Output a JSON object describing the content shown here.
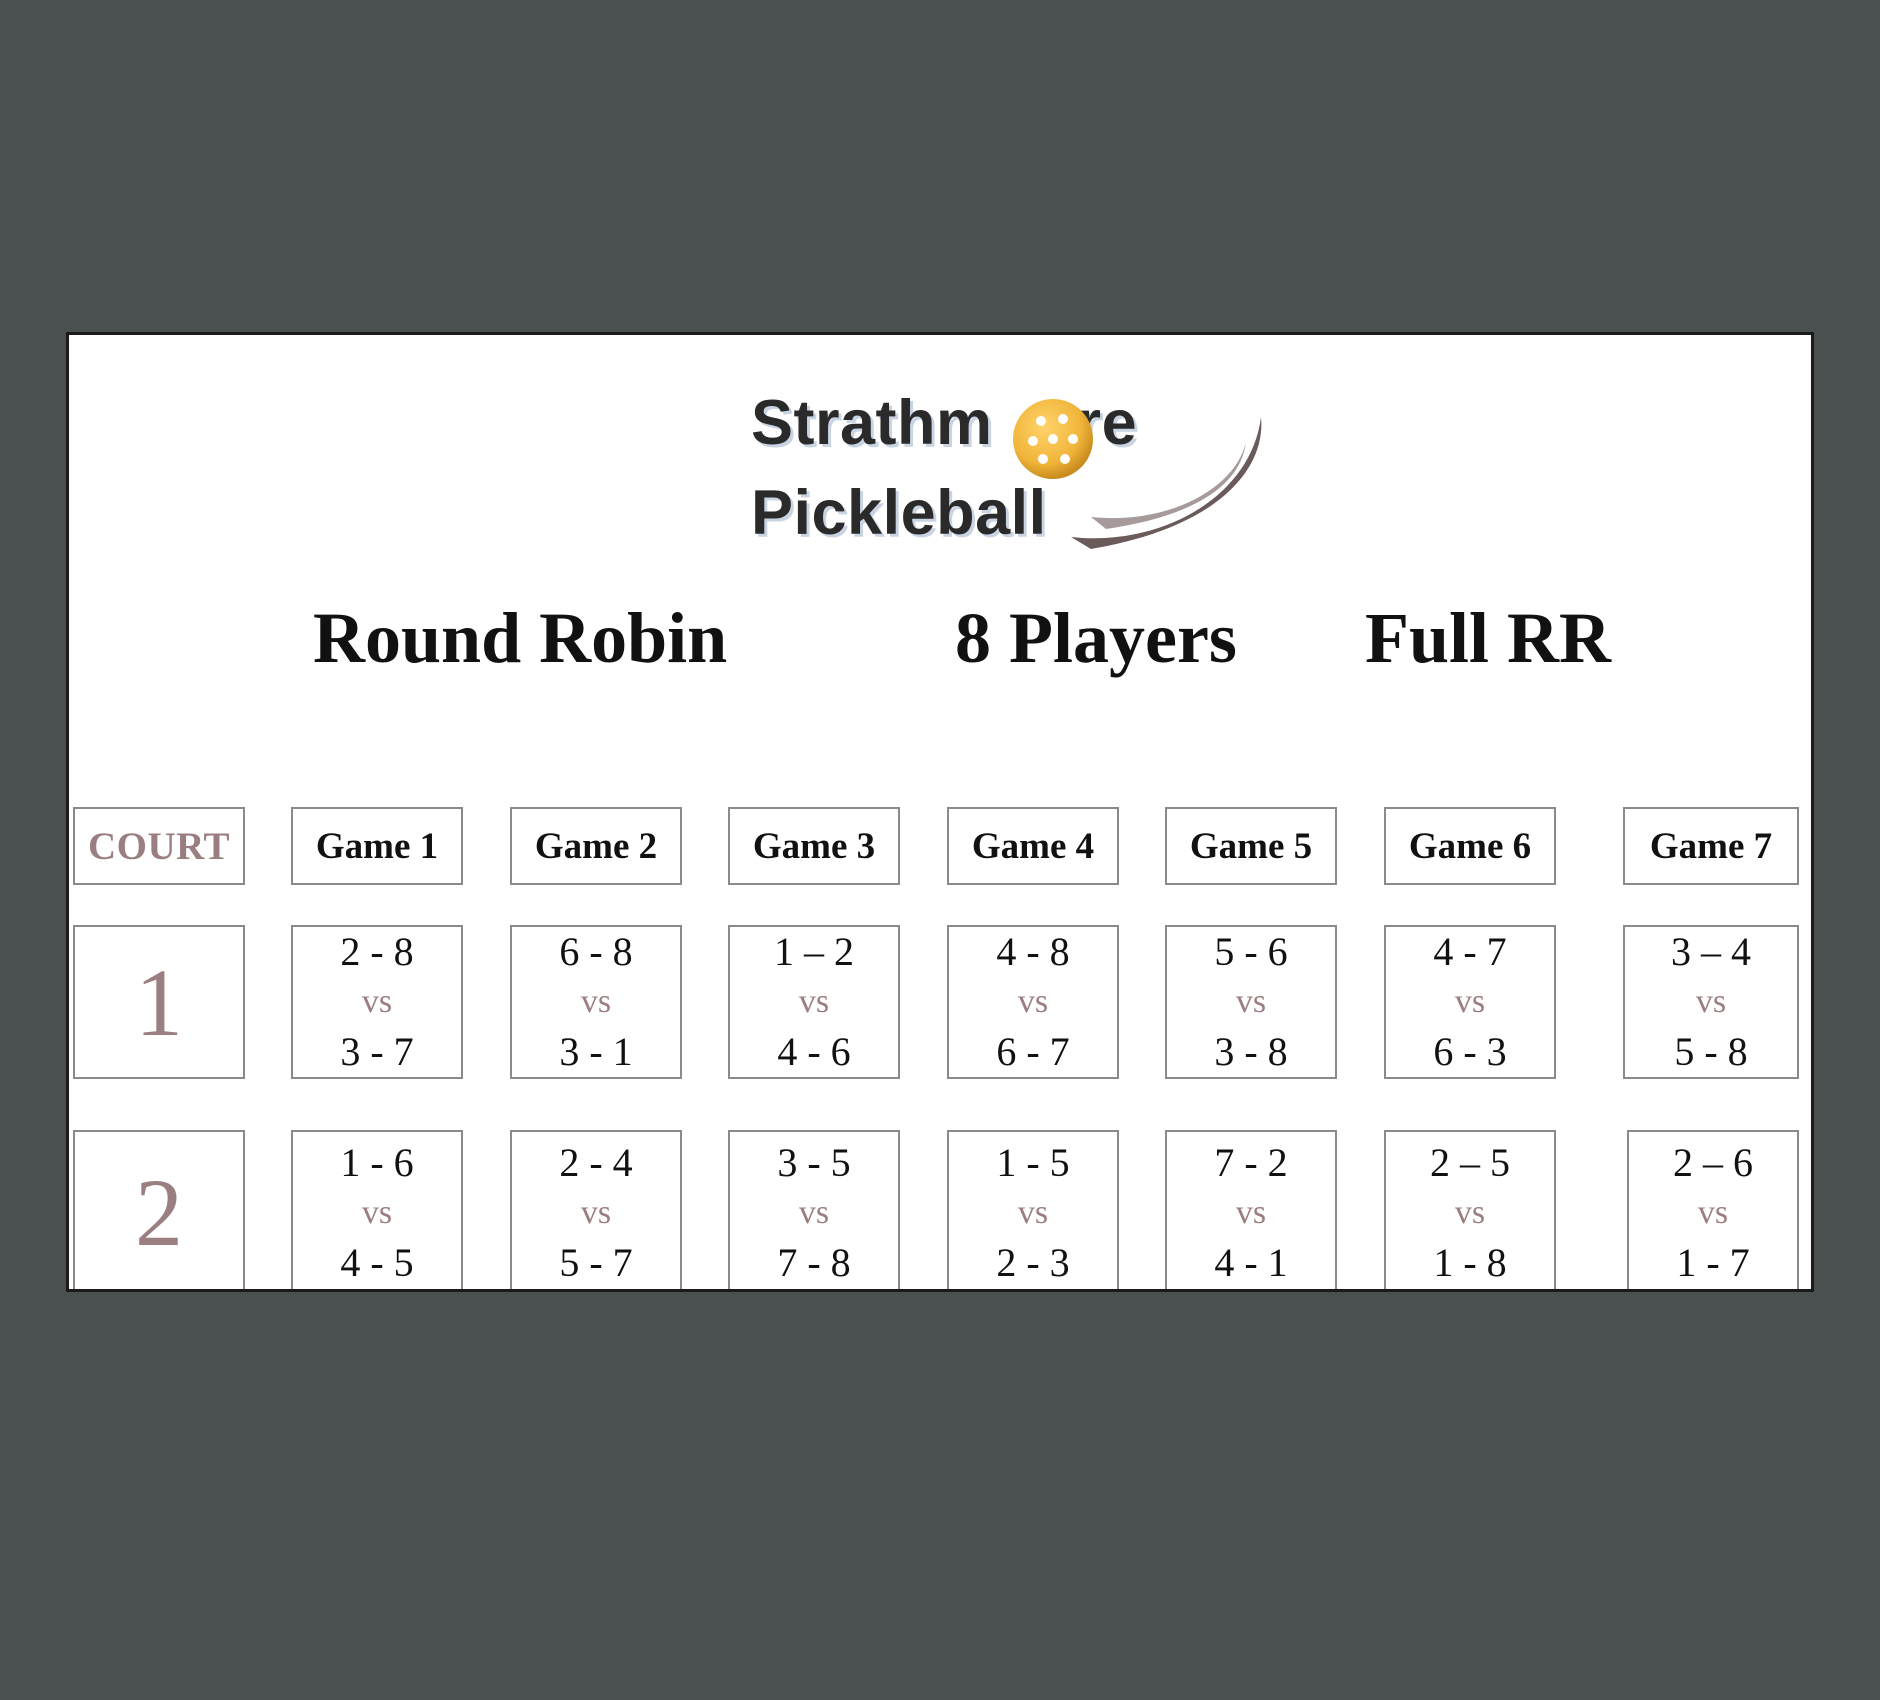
{
  "logo": {
    "line1_a": "Strathm",
    "line1_b": "re",
    "line2": "Pickleball",
    "ball_color": "#f0b53a",
    "swoosh_color": "#6a5a5a"
  },
  "heading": {
    "title": "Round Robin",
    "players": "8 Players",
    "format": "Full RR"
  },
  "colors": {
    "accent": "#9b7f80",
    "border": "#8a8a8a",
    "background": "#4a5050"
  },
  "table": {
    "court_header": "COURT",
    "vs_label": "vs",
    "games": [
      "Game 1",
      "Game 2",
      "Game 3",
      "Game 4",
      "Game 5",
      "Game 6",
      "Game 7"
    ],
    "courts": [
      {
        "number": "1",
        "matches": [
          {
            "team1": "2 - 8",
            "team2": "3 - 7"
          },
          {
            "team1": "6 - 8",
            "team2": "3 - 1"
          },
          {
            "team1": "1 – 2",
            "team2": "4 - 6"
          },
          {
            "team1": "4 - 8",
            "team2": "6 - 7"
          },
          {
            "team1": "5 - 6",
            "team2": "3 - 8"
          },
          {
            "team1": "4 - 7",
            "team2": "6 - 3"
          },
          {
            "team1": "3 – 4",
            "team2": "5 - 8"
          }
        ]
      },
      {
        "number": "2",
        "matches": [
          {
            "team1": "1 - 6",
            "team2": "4 - 5"
          },
          {
            "team1": "2 - 4",
            "team2": "5 - 7"
          },
          {
            "team1": "3 - 5",
            "team2": "7 - 8"
          },
          {
            "team1": "1 - 5",
            "team2": "2 - 3"
          },
          {
            "team1": "7 - 2",
            "team2": "4 - 1"
          },
          {
            "team1": "2 – 5",
            "team2": "1 - 8"
          },
          {
            "team1": "2 – 6",
            "team2": "1 - 7"
          }
        ]
      }
    ]
  }
}
